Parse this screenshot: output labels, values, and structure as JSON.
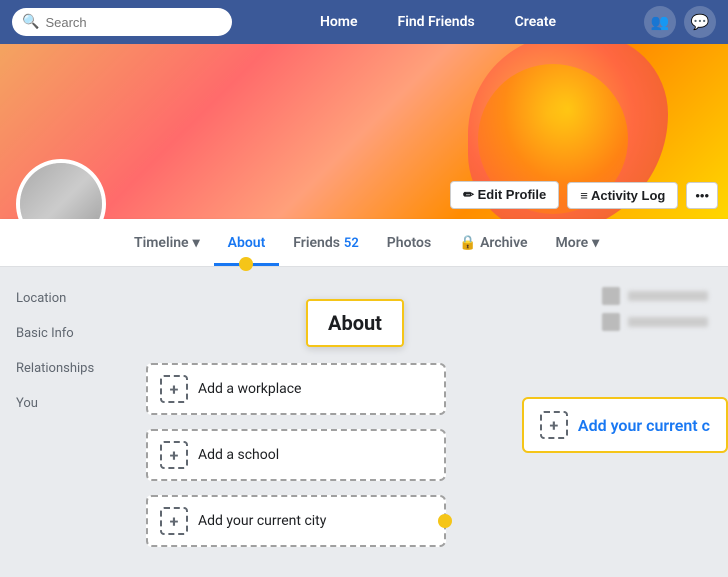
{
  "nav": {
    "search_placeholder": "Search",
    "links": [
      "Home",
      "Find Friends",
      "Create"
    ],
    "icons": [
      "people-icon",
      "messenger-icon"
    ]
  },
  "profile": {
    "edit_profile_label": "✏ Edit Profile",
    "activity_log_label": "≡ Activity Log",
    "more_options_label": "•••"
  },
  "tabs": [
    {
      "id": "timeline",
      "label": "Timeline",
      "has_dropdown": true
    },
    {
      "id": "about",
      "label": "About",
      "active": true
    },
    {
      "id": "friends",
      "label": "Friends",
      "count": "52"
    },
    {
      "id": "photos",
      "label": "Photos"
    },
    {
      "id": "archive",
      "label": "🔒 Archive"
    },
    {
      "id": "more",
      "label": "More",
      "has_dropdown": true
    }
  ],
  "sidebar": {
    "items": [
      {
        "id": "location",
        "label": "Location"
      },
      {
        "id": "basic-info",
        "label": "Basic Info"
      },
      {
        "id": "relationships",
        "label": "Relationships"
      },
      {
        "id": "you",
        "label": "You"
      }
    ]
  },
  "about_tooltip": {
    "label": "About"
  },
  "add_items": [
    {
      "id": "add-workplace",
      "label": "Add a workplace"
    },
    {
      "id": "add-school",
      "label": "Add a school"
    },
    {
      "id": "add-city",
      "label": "Add your current city"
    }
  ],
  "floating_add": {
    "label": "Add your current c"
  }
}
